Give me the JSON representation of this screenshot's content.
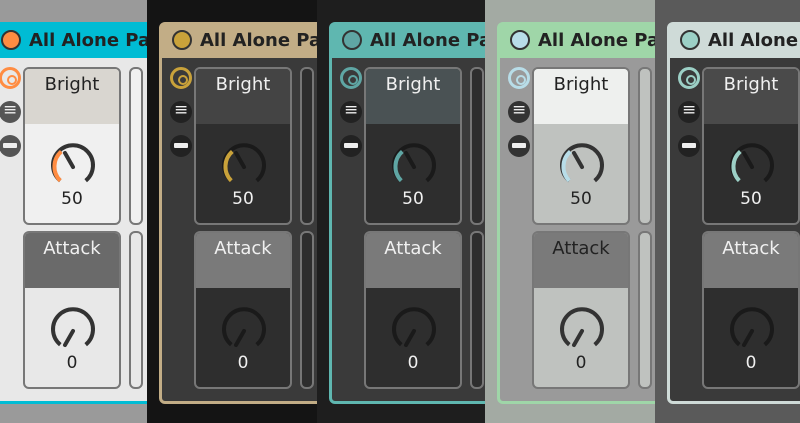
{
  "device": {
    "title": "All Alone Pad"
  },
  "parameters": {
    "bright": {
      "label": "Bright",
      "value": "50"
    },
    "attack": {
      "label": "Attack",
      "value": "0"
    }
  },
  "icons": [
    "power-icon",
    "list-icon",
    "bar-icon"
  ],
  "themes": [
    {
      "name": "light-blue",
      "accent": "#00bcd4",
      "bright_arc": "#ff8c42"
    },
    {
      "name": "tan",
      "accent": "#c2ad86",
      "bright_arc": "#c9a23a"
    },
    {
      "name": "teal",
      "accent": "#5fb7b0",
      "bright_arc": "#5fa6a4"
    },
    {
      "name": "mint",
      "accent": "#9fd6a8",
      "bright_arc": "#b8dde8"
    },
    {
      "name": "grey-teal",
      "accent": "#cfdbd8",
      "bright_arc": "#9cd0c6"
    }
  ]
}
